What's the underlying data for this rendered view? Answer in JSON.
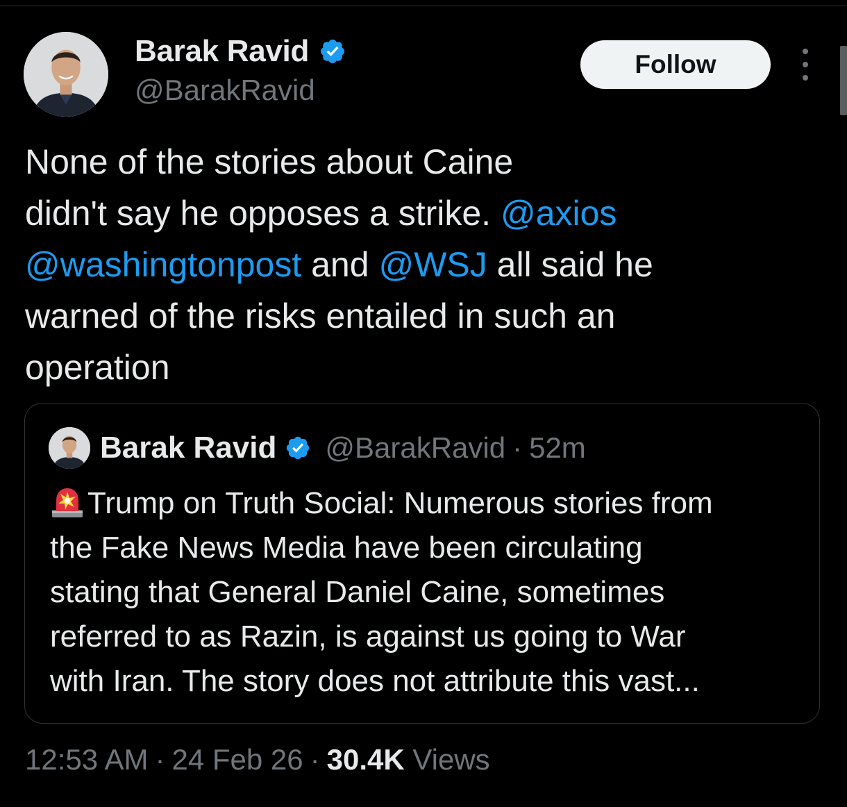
{
  "author": {
    "name": "Barak Ravid",
    "handle": "@BarakRavid",
    "verified": true
  },
  "follow_label": "Follow",
  "tweet": {
    "lines": [
      "None of the stories about Caine",
      "didn't say he opposes a strike. ",
      " and ",
      " all said he",
      "warned of the risks entailed in such an",
      "operation"
    ],
    "mentions": [
      "@axios",
      "@washingtonpost",
      "@WSJ"
    ]
  },
  "quoted": {
    "name": "Barak Ravid",
    "handle": "@BarakRavid",
    "separator": "·",
    "time": "52m",
    "emoji_icon": "police-car-light-icon",
    "lines": [
      "Trump on Truth Social: Numerous stories from",
      "the Fake News Media have been circulating",
      "stating that General Daniel Caine, sometimes",
      "referred to as Razin, is against us going to War",
      "with Iran. The story does not attribute this vast..."
    ]
  },
  "meta": {
    "time": "12:53 AM",
    "separator": "·",
    "date": "24 Feb 26",
    "views_count": "30.4K",
    "views_label": "Views"
  },
  "colors": {
    "background": "#000000",
    "text": "#e7e9ea",
    "secondary": "#71767b",
    "link": "#1d9bf0",
    "verified": "#1d9bf0",
    "border": "#2f3336",
    "button_bg": "#eff3f4"
  }
}
